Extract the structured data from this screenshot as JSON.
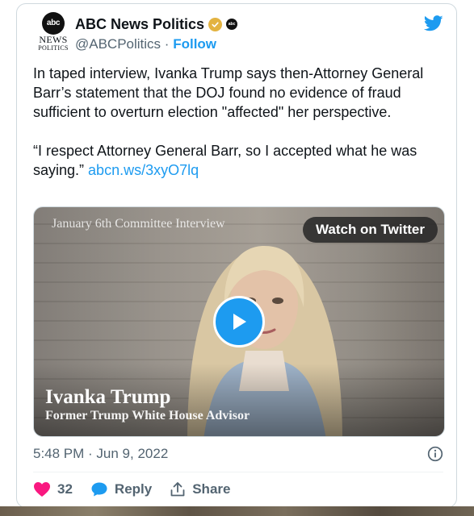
{
  "account": {
    "display_name": "ABC News Politics",
    "handle": "@ABCPolitics",
    "separator": "·",
    "follow_label": "Follow",
    "avatar": {
      "logo_text": "abc",
      "line1": "NEWS",
      "line2": "POLITICS"
    },
    "verified_color": "#e3b341"
  },
  "tweet": {
    "paragraph1": "In taped interview, Ivanka Trump says then-Attorney General Barr’s statement that the DOJ found no evidence of fraud sufficient to overturn election \"affected\" her perspective.",
    "quote": "“I respect Attorney General Barr, so I accepted what he was saying.”",
    "link": "abcn.ws/3xyO7lq"
  },
  "media": {
    "overlay_label": "January 6th Committee Interview",
    "watch_button": "Watch on Twitter",
    "caption_name": "Ivanka Trump",
    "caption_role": "Former Trump White House Advisor"
  },
  "meta": {
    "timestamp": "5:48 PM · Jun 9, 2022"
  },
  "actions": {
    "like_count": "32",
    "reply_label": "Reply",
    "share_label": "Share"
  },
  "colors": {
    "accent": "#1d9bf0",
    "like": "#f91880",
    "muted": "#536471"
  },
  "icons": [
    "twitter-bird-icon",
    "verified-badge-icon",
    "abc-affiliate-icon",
    "play-icon",
    "info-icon",
    "heart-icon",
    "reply-bubble-icon",
    "share-icon"
  ]
}
